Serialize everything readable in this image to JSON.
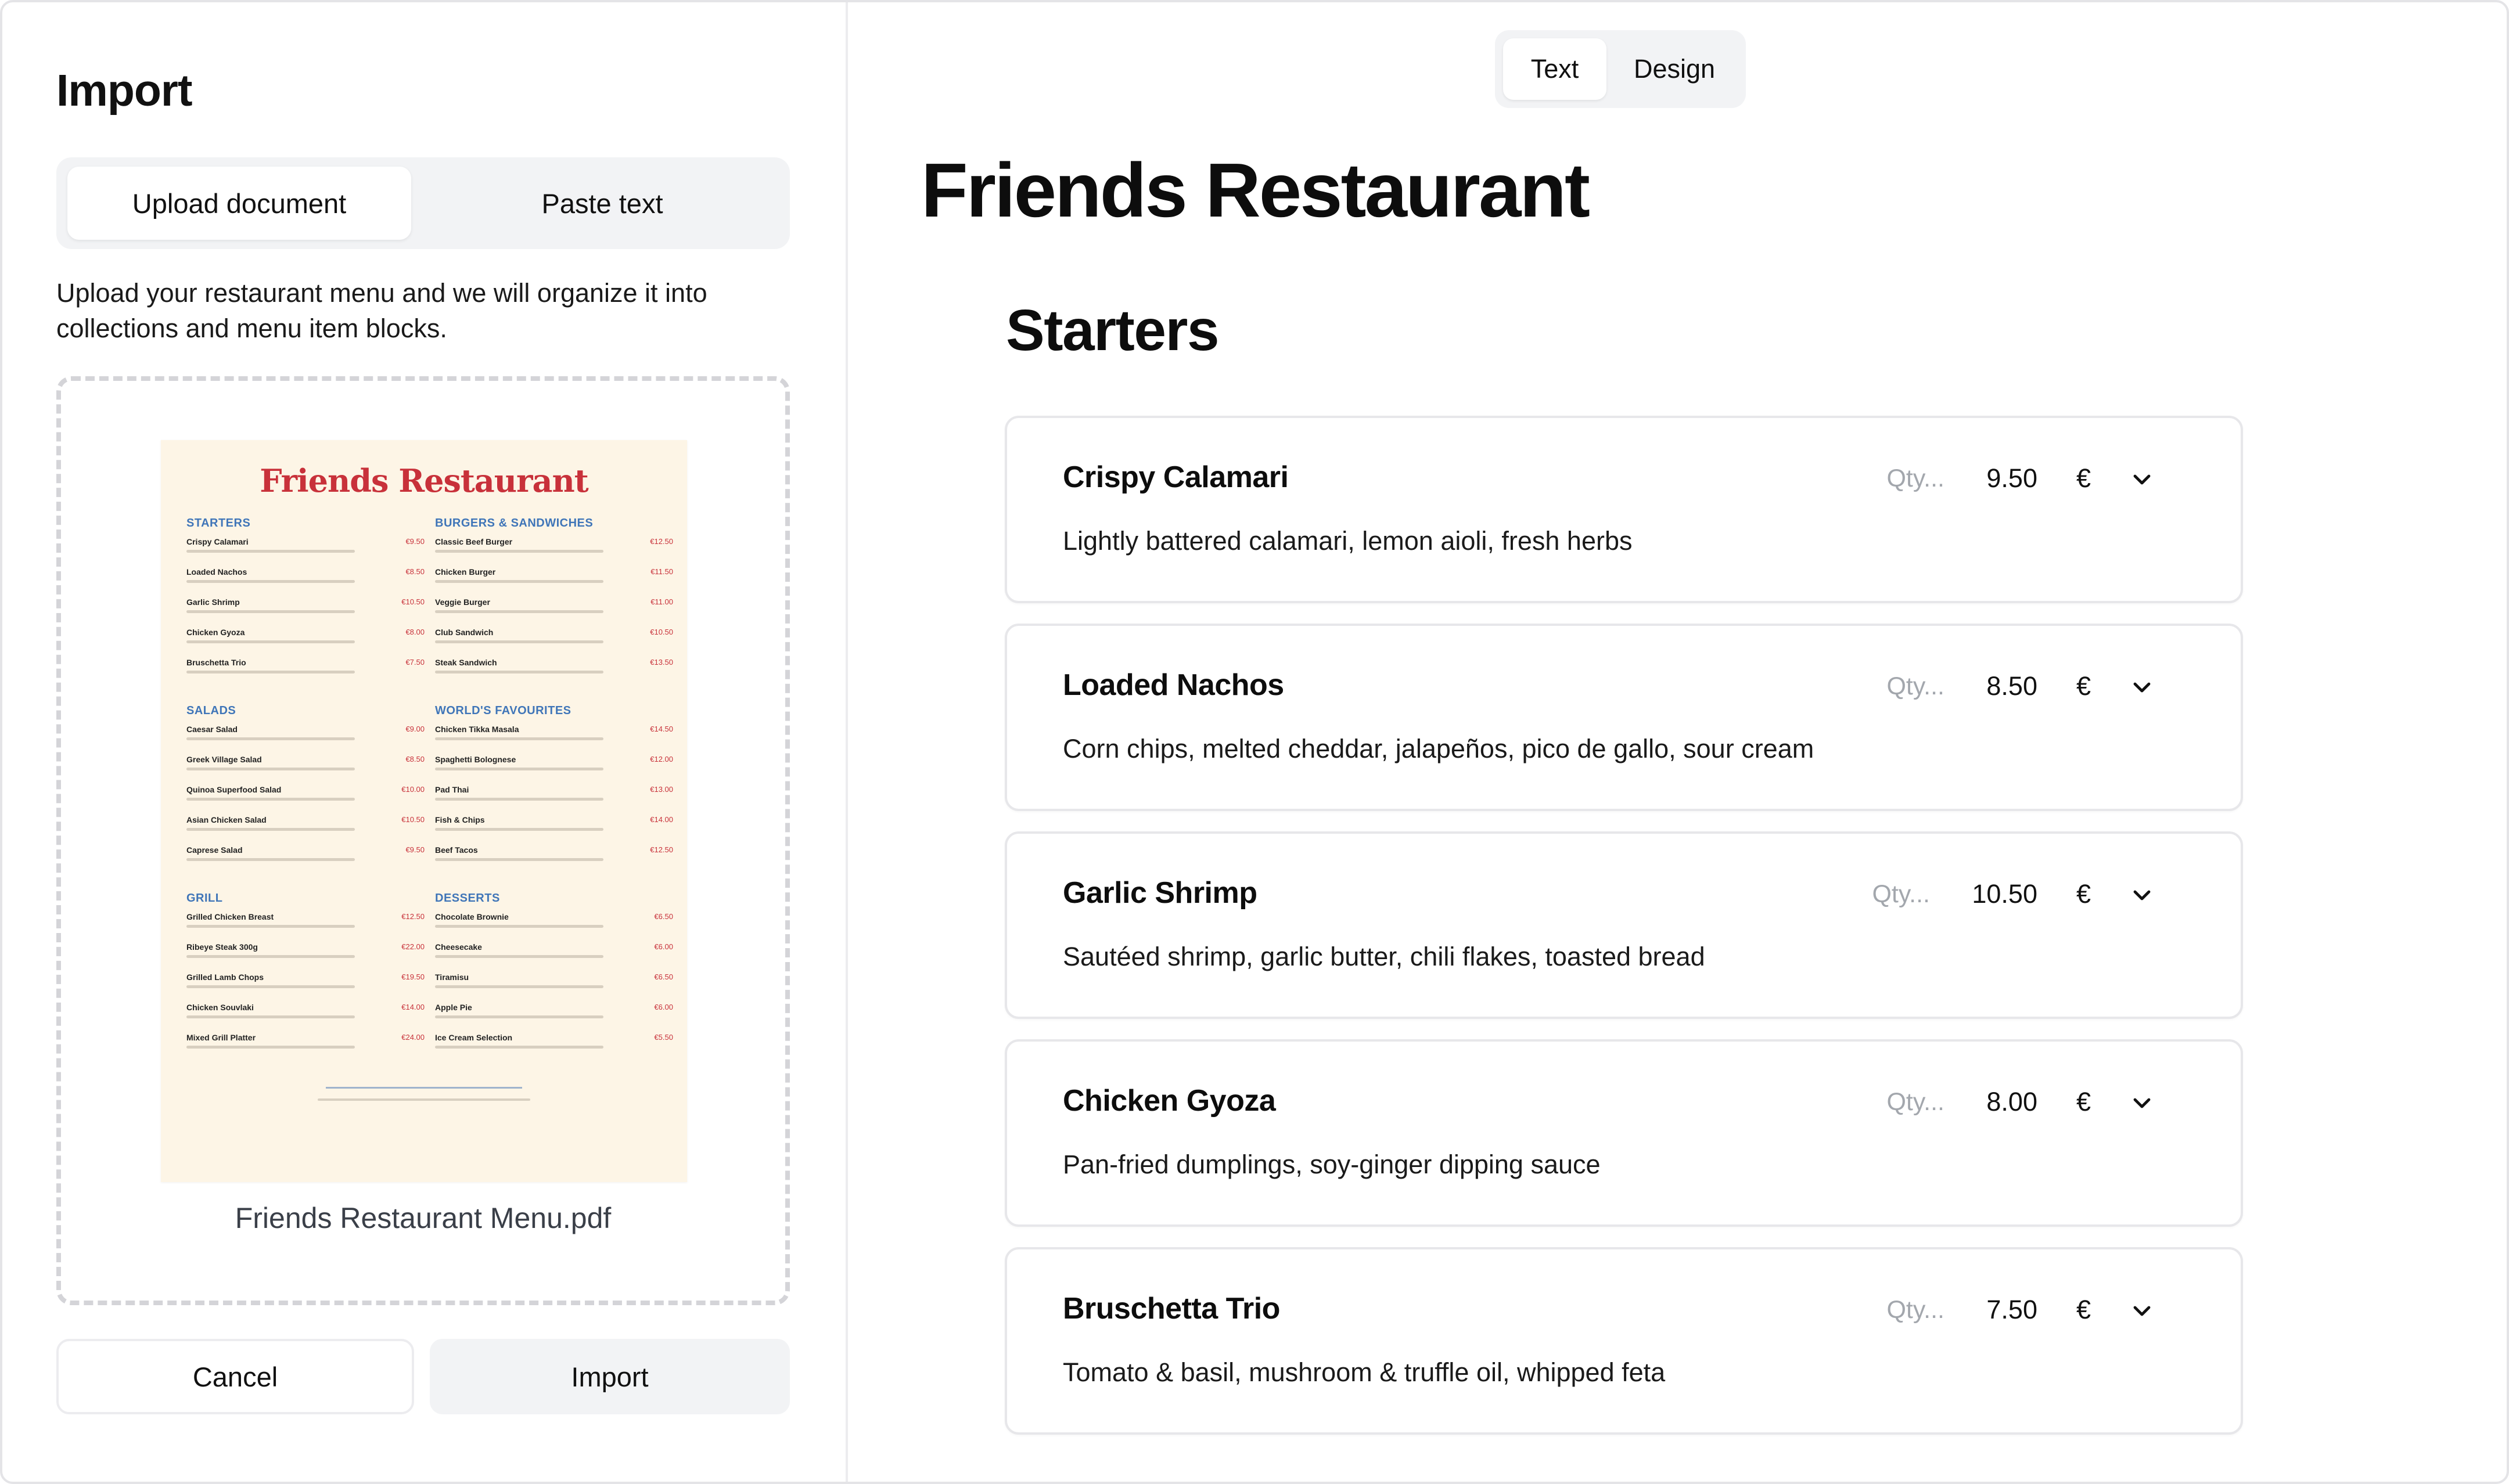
{
  "import_panel": {
    "title": "Import",
    "tabs": [
      {
        "label": "Upload document",
        "active": true
      },
      {
        "label": "Paste text",
        "active": false
      }
    ],
    "description": "Upload your restaurant menu and we will organize it into collections and menu item blocks.",
    "file_name": "Friends Restaurant Menu.pdf",
    "cancel_label": "Cancel",
    "import_label": "Import",
    "menu_preview": {
      "title": "Friends Restaurant",
      "columns": [
        [
          {
            "heading": "Starters",
            "items": [
              {
                "name": "Crispy Calamari",
                "price": "€9.50"
              },
              {
                "name": "Loaded Nachos",
                "price": "€8.50"
              },
              {
                "name": "Garlic Shrimp",
                "price": "€10.50"
              },
              {
                "name": "Chicken Gyoza",
                "price": "€8.00"
              },
              {
                "name": "Bruschetta Trio",
                "price": "€7.50"
              }
            ]
          },
          {
            "heading": "Salads",
            "items": [
              {
                "name": "Caesar Salad",
                "price": "€9.00"
              },
              {
                "name": "Greek Village Salad",
                "price": "€8.50"
              },
              {
                "name": "Quinoa Superfood Salad",
                "price": "€10.00"
              },
              {
                "name": "Asian Chicken Salad",
                "price": "€10.50"
              },
              {
                "name": "Caprese Salad",
                "price": "€9.50"
              }
            ]
          },
          {
            "heading": "Grill",
            "items": [
              {
                "name": "Grilled Chicken Breast",
                "price": "€12.50"
              },
              {
                "name": "Ribeye Steak 300g",
                "price": "€22.00"
              },
              {
                "name": "Grilled Lamb Chops",
                "price": "€19.50"
              },
              {
                "name": "Chicken Souvlaki",
                "price": "€14.00"
              },
              {
                "name": "Mixed Grill Platter",
                "price": "€24.00"
              }
            ]
          }
        ],
        [
          {
            "heading": "Burgers & Sandwiches",
            "items": [
              {
                "name": "Classic Beef Burger",
                "price": "€12.50"
              },
              {
                "name": "Chicken Burger",
                "price": "€11.50"
              },
              {
                "name": "Veggie Burger",
                "price": "€11.00"
              },
              {
                "name": "Club Sandwich",
                "price": "€10.50"
              },
              {
                "name": "Steak Sandwich",
                "price": "€13.50"
              }
            ]
          },
          {
            "heading": "World's Favourites",
            "items": [
              {
                "name": "Chicken Tikka Masala",
                "price": "€14.50"
              },
              {
                "name": "Spaghetti Bolognese",
                "price": "€12.00"
              },
              {
                "name": "Pad Thai",
                "price": "€13.00"
              },
              {
                "name": "Fish & Chips",
                "price": "€14.00"
              },
              {
                "name": "Beef Tacos",
                "price": "€12.50"
              }
            ]
          },
          {
            "heading": "Desserts",
            "items": [
              {
                "name": "Chocolate Brownie",
                "price": "€6.50"
              },
              {
                "name": "Cheesecake",
                "price": "€6.00"
              },
              {
                "name": "Tiramisu",
                "price": "€6.50"
              },
              {
                "name": "Apple Pie",
                "price": "€6.00"
              },
              {
                "name": "Ice Cream Selection",
                "price": "€5.50"
              }
            ]
          }
        ]
      ]
    }
  },
  "editor": {
    "view_tabs": [
      {
        "label": "Text",
        "active": true
      },
      {
        "label": "Design",
        "active": false
      }
    ],
    "restaurant_name": "Friends Restaurant",
    "section_title": "Starters",
    "qty_placeholder": "Qty...",
    "currency": "€",
    "items": [
      {
        "name": "Crispy Calamari",
        "price": "9.50",
        "description": "Lightly battered calamari, lemon aioli, fresh herbs"
      },
      {
        "name": "Loaded Nachos",
        "price": "8.50",
        "description": "Corn chips, melted cheddar, jalapeños, pico de gallo, sour cream"
      },
      {
        "name": "Garlic Shrimp",
        "price": "10.50",
        "description": "Sautéed shrimp, garlic butter, chili flakes, toasted bread"
      },
      {
        "name": "Chicken Gyoza",
        "price": "8.00",
        "description": "Pan-fried dumplings, soy-ginger dipping sauce"
      },
      {
        "name": "Bruschetta Trio",
        "price": "7.50",
        "description": "Tomato & basil, mushroom & truffle oil, whipped feta"
      }
    ]
  }
}
